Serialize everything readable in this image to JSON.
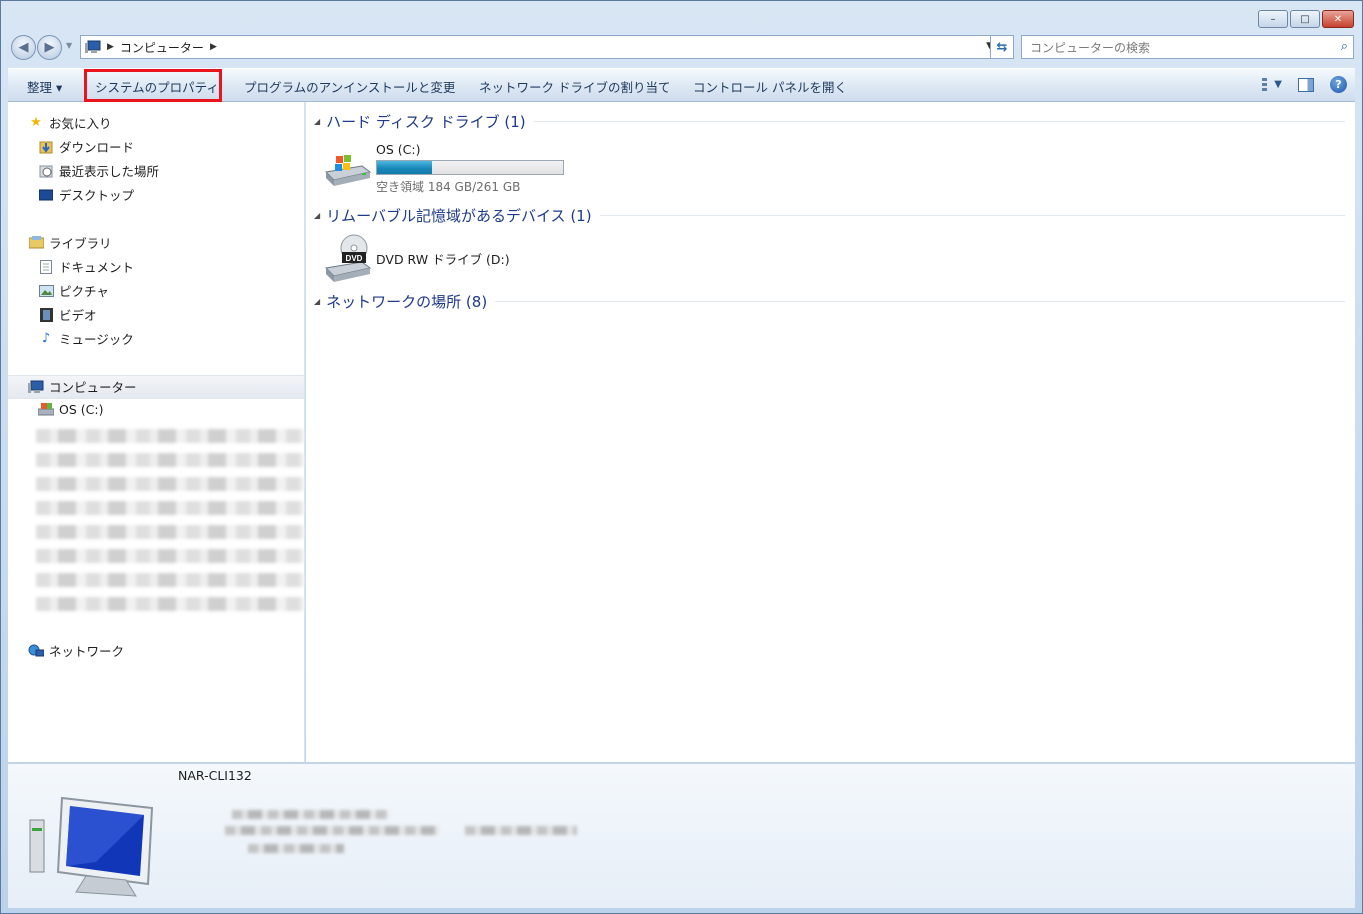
{
  "window": {
    "controls": {
      "minimize": "–",
      "maximize": "□",
      "close": "✕"
    }
  },
  "address": {
    "crumb": "コンピューター",
    "search_placeholder": "コンピューターの検索"
  },
  "toolbar": {
    "organize": "整理 ▾",
    "system_properties": "システムのプロパティ",
    "uninstall": "プログラムのアンインストールと変更",
    "map_drive": "ネットワーク ドライブの割り当て",
    "control_panel": "コントロール パネルを開く",
    "help": "?"
  },
  "sidebar": {
    "favorites": {
      "label": "お気に入り",
      "items": [
        "ダウンロード",
        "最近表示した場所",
        "デスクトップ"
      ]
    },
    "libraries": {
      "label": "ライブラリ",
      "items": [
        "ドキュメント",
        "ピクチャ",
        "ビデオ",
        "ミュージック"
      ]
    },
    "computer": {
      "label": "コンピューター",
      "items": [
        "OS (C:)"
      ]
    },
    "network": {
      "label": "ネットワーク"
    }
  },
  "main": {
    "groups": [
      {
        "label": "ハード ディスク ドライブ (1)"
      },
      {
        "label": "リムーバブル記憶域があるデバイス (1)"
      },
      {
        "label": "ネットワークの場所 (8)"
      }
    ],
    "drive_c": {
      "name": "OS (C:)",
      "free_text": "空き領域 184 GB/261 GB",
      "used_fraction": 0.295
    },
    "drive_d": {
      "name": "DVD RW ドライブ (D:)",
      "badge": "DVD"
    }
  },
  "details": {
    "computer_name": "NAR-CLI132"
  },
  "colors": {
    "accent_red": "#e8141e",
    "group_header": "#1e3a8a",
    "capacity_fill": "#1a88bb"
  }
}
